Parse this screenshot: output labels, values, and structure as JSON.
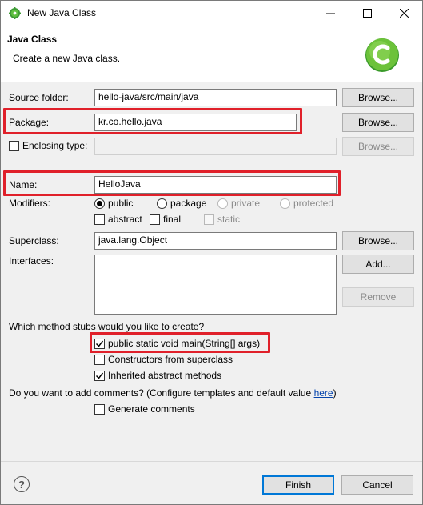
{
  "window": {
    "title": "New Java Class"
  },
  "banner": {
    "heading": "Java Class",
    "description": "Create a new Java class."
  },
  "form": {
    "source_folder": {
      "label": "Source folder:",
      "value": "hello-java/src/main/java",
      "button": "Browse..."
    },
    "package": {
      "label": "Package:",
      "value": "kr.co.hello.java",
      "button": "Browse..."
    },
    "enclosing_type": {
      "label": "Enclosing type:",
      "value": "",
      "button": "Browse..."
    },
    "name": {
      "label": "Name:",
      "value": "HelloJava"
    },
    "modifiers": {
      "label": "Modifiers:",
      "radios": [
        "public",
        "package",
        "private",
        "protected"
      ],
      "checks": [
        "abstract",
        "final",
        "static"
      ]
    },
    "superclass": {
      "label": "Superclass:",
      "value": "java.lang.Object",
      "button": "Browse..."
    },
    "interfaces": {
      "label": "Interfaces:",
      "add_button": "Add...",
      "remove_button": "Remove"
    },
    "stubs": {
      "question": "Which method stubs would you like to create?",
      "options": [
        "public static void main(String[] args)",
        "Constructors from superclass",
        "Inherited abstract methods"
      ]
    },
    "comments": {
      "question": "Do you want to add comments? (Configure templates and default value ",
      "link": "here",
      "close": ")",
      "option": "Generate comments"
    }
  },
  "footer": {
    "help": "?",
    "finish": "Finish",
    "cancel": "Cancel"
  },
  "colors": {
    "highlight": "#e0202a",
    "accent": "#0078d7"
  }
}
